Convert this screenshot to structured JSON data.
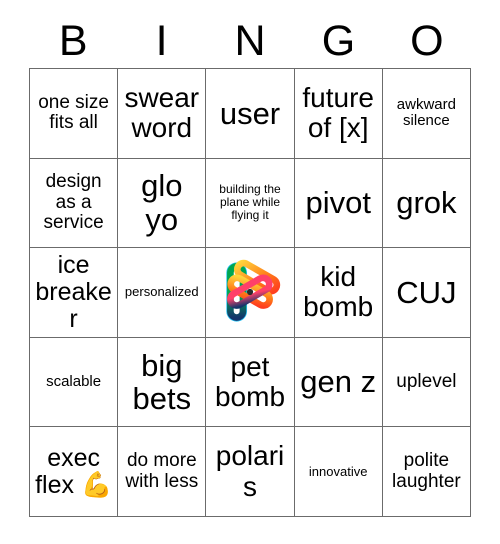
{
  "header": {
    "letters": [
      "B",
      "I",
      "N",
      "G",
      "O"
    ]
  },
  "grid": {
    "rows": [
      [
        {
          "text": "one size fits all",
          "size": "md"
        },
        {
          "text": "swear word",
          "size": "xl"
        },
        {
          "text": "user",
          "size": "xxl"
        },
        {
          "text": "future of [x]",
          "size": "xl"
        },
        {
          "text": "awkward silence",
          "size": "sm"
        }
      ],
      [
        {
          "text": "design as a service",
          "size": "md"
        },
        {
          "text": "glo yo",
          "size": "xxl"
        },
        {
          "text": "building the plane while flying it",
          "size": "xxs"
        },
        {
          "text": "pivot",
          "size": "xxl"
        },
        {
          "text": "grok",
          "size": "xxl"
        }
      ],
      [
        {
          "text": "ice breaker",
          "size": "lg"
        },
        {
          "text": "personalized",
          "size": "xs"
        },
        {
          "text": "",
          "size": "md",
          "icon": "labs-logo-icon"
        },
        {
          "text": "kid bomb",
          "size": "xl"
        },
        {
          "text": "CUJ",
          "size": "xxl"
        }
      ],
      [
        {
          "text": "scalable",
          "size": "sm"
        },
        {
          "text": "big bets",
          "size": "xxl"
        },
        {
          "text": "pet bomb",
          "size": "xl"
        },
        {
          "text": "gen z",
          "size": "xxl"
        },
        {
          "text": "uplevel",
          "size": "md"
        }
      ],
      [
        {
          "text": "exec flex 💪",
          "size": "lg"
        },
        {
          "text": "do more with less",
          "size": "md"
        },
        {
          "text": "polaris",
          "size": "xl"
        },
        {
          "text": "innovative",
          "size": "xs"
        },
        {
          "text": "polite laughter",
          "size": "md"
        }
      ]
    ]
  },
  "logo": {
    "name": "labs-logo-icon",
    "colors": {
      "green": "#00A651",
      "cyan": "#29C5F6",
      "yellow": "#FFD63D",
      "orange": "#FF5A1F",
      "pink": "#FF4069",
      "navy": "#13356B",
      "center": "#2B2B2B"
    }
  },
  "colors": {
    "grid_border": "#6b6b6b",
    "text": "#000000",
    "background": "#ffffff"
  }
}
